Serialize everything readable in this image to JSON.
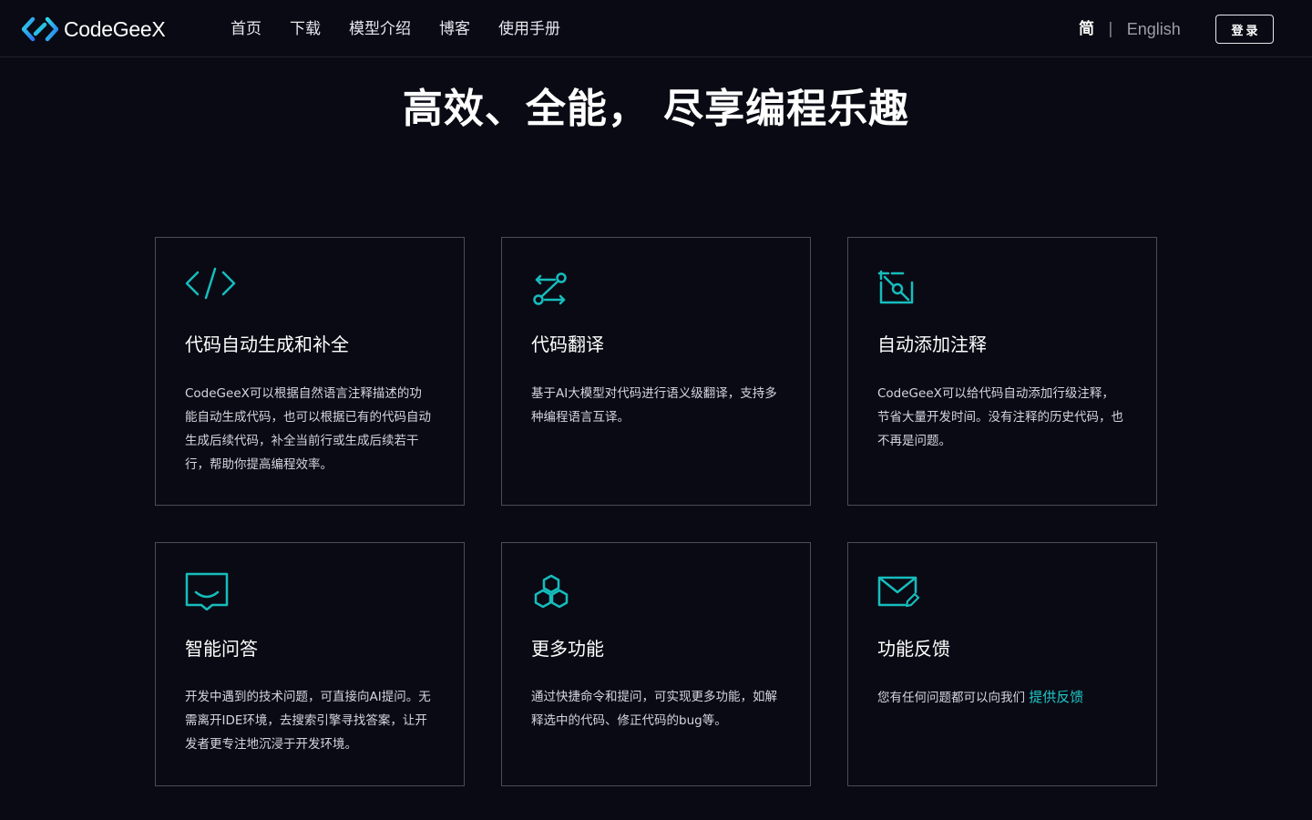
{
  "header": {
    "logo_text": "CodeGeeX",
    "nav": [
      "首页",
      "下载",
      "模型介绍",
      "博客",
      "使用手册"
    ],
    "lang_cn": "简",
    "lang_sep": "|",
    "lang_en": "English",
    "login_label": "登录"
  },
  "hero": {
    "title": "高效、全能， 尽享编程乐趣"
  },
  "features": [
    {
      "icon": "code-icon",
      "title": "代码自动生成和补全",
      "desc": "CodeGeeX可以根据自然语言注释描述的功能自动生成代码，也可以根据已有的代码自动生成后续代码，补全当前行或生成后续若干行，帮助你提高编程效率。"
    },
    {
      "icon": "translate-icon",
      "title": "代码翻译",
      "desc": "基于AI大模型对代码进行语义级翻译，支持多种编程语言互译。"
    },
    {
      "icon": "comment-icon",
      "title": "自动添加注释",
      "desc": "CodeGeeX可以给代码自动添加行级注释，节省大量开发时间。没有注释的历史代码，也不再是问题。"
    },
    {
      "icon": "chat-icon",
      "title": "智能问答",
      "desc": "开发中遇到的技术问题，可直接向AI提问。无需离开IDE环境，去搜索引擎寻找答案，让开发者更专注地沉浸于开发环境。"
    },
    {
      "icon": "cubes-icon",
      "title": "更多功能",
      "desc": "通过快捷命令和提问，可实现更多功能，如解释选中的代码、修正代码的bug等。"
    },
    {
      "icon": "mail-edit-icon",
      "title": "功能反馈",
      "desc": "您有任何问题都可以向我们",
      "link_label": "提供反馈"
    }
  ],
  "colors": {
    "background": "#0a0a14",
    "accent": "#16bdbd",
    "card_border": "#4a4d5a"
  }
}
